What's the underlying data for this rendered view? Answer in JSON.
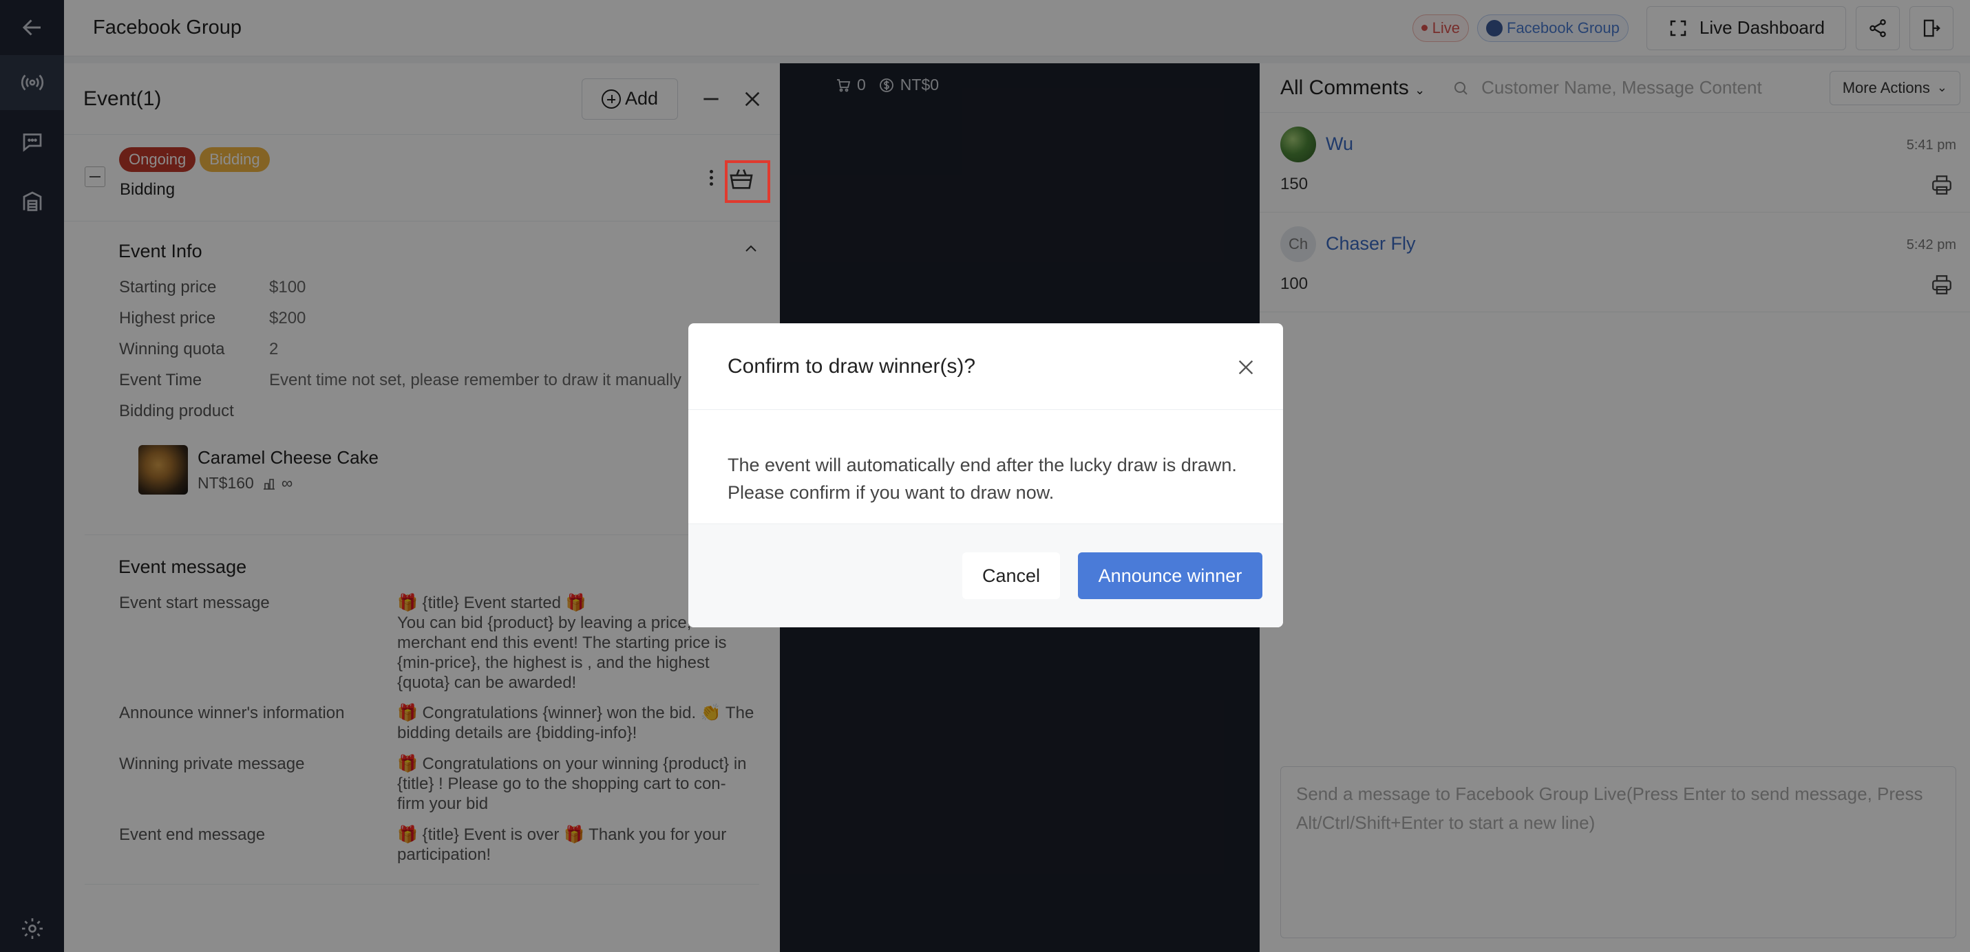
{
  "topbar": {
    "title": "Facebook Group",
    "live_label": "Live",
    "platform_label": "Facebook Group",
    "dashboard_label": "Live Dashboard"
  },
  "events": {
    "title": "Event(1)",
    "add_label": "Add",
    "item": {
      "status_tag": "Ongoing",
      "type_tag": "Bidding",
      "name": "Bidding"
    },
    "info_title": "Event Info",
    "info": [
      {
        "label": "Starting price",
        "value": "$100"
      },
      {
        "label": "Highest price",
        "value": "$200"
      },
      {
        "label": "Winning quota",
        "value": "2"
      },
      {
        "label": "Event Time",
        "value": "Event time not set, please remember to draw it manually"
      }
    ],
    "product_label": "Bidding product",
    "product": {
      "name": "Caramel Cheese Cake",
      "price": "NT$160",
      "stock": "∞"
    },
    "message_title": "Event message",
    "messages": [
      {
        "label": "Event start message",
        "lines": [
          "🎁 {title} Event started 🎁",
          "You can bid {product} by leaving a price,",
          "merchant end this event! The starting price is",
          "{min-price}, the highest is , and the highest",
          "{quota} can be awarded!"
        ]
      },
      {
        "label": "Announce winner's information",
        "lines": [
          "🎁 Congratulations {winner} won the bid. 👏 The",
          "bidding details are {bidding-info}!"
        ]
      },
      {
        "label": "Winning private message",
        "lines": [
          "🎁 Congratulations on your winning {product} in",
          "{title} ! Please go to the shopping cart to con-",
          "firm your bid"
        ]
      },
      {
        "label": "Event end message",
        "lines": [
          "🎁 {title} Event is over 🎁 Thank you for your",
          "participation!"
        ]
      }
    ]
  },
  "video": {
    "cart_count": "0",
    "amount": "NT$0"
  },
  "comments": {
    "filter_label": "All Comments",
    "search_placeholder": "Customer Name, Message Content",
    "more_actions": "More Actions",
    "items": [
      {
        "name": "Wu",
        "time": "5:41 pm",
        "text": "150",
        "avatar": ""
      },
      {
        "name": "Chaser Fly",
        "time": "5:42 pm",
        "text": "100",
        "avatar": "Ch"
      }
    ],
    "message_placeholder": "Send a message to Facebook Group Live(Press Enter to send message, Press Alt/Ctrl/Shift+Enter to start a new line)"
  },
  "modal": {
    "title": "Confirm to draw winner(s)?",
    "body_lines": [
      "The event will automatically end after the lucky draw is drawn.",
      "Please confirm if you want to draw now."
    ],
    "cancel_label": "Cancel",
    "confirm_label": "Announce winner"
  },
  "colors": {
    "accent": "#4a7bd8",
    "live": "#d9534f",
    "ongoing": "#c0392b",
    "bidding": "#f0b443",
    "highlight": "#e03a2f"
  }
}
